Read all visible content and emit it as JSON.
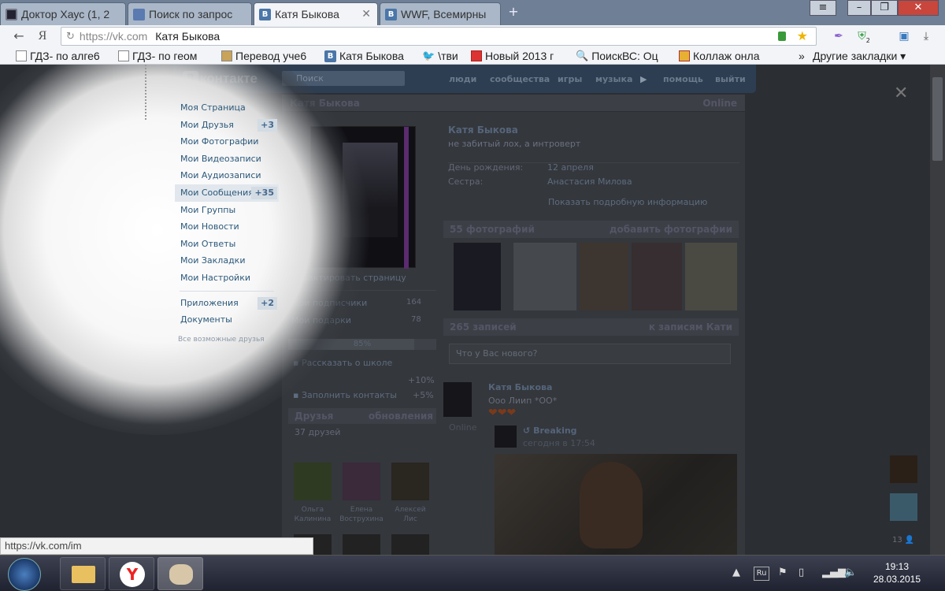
{
  "tabs": [
    {
      "title": "Доктор Хаус (1, 2",
      "icon": "film-icon"
    },
    {
      "title": "Поиск по запрос",
      "icon": "video-icon"
    },
    {
      "title": "Катя Быкова",
      "icon": "vk-icon"
    },
    {
      "title": "WWF, Всемирны",
      "icon": "vk-icon"
    }
  ],
  "toolbar": {
    "yandex_label": "Я",
    "url": "https://vk.com",
    "page_title": "Катя Быкова",
    "ext_badge": "2"
  },
  "bookmarks": [
    {
      "label": "ГДЗ- по алге6",
      "icon": "document-icon"
    },
    {
      "label": "ГДЗ- по геом",
      "icon": "document-icon"
    },
    {
      "label": "Перевод уче6",
      "icon": "translate-icon"
    },
    {
      "label": "Катя Быкова",
      "icon": "vk-icon"
    },
    {
      "label": "\\тви",
      "icon": "twitter-icon"
    },
    {
      "label": "Новый 2013 г",
      "icon": "gift-icon"
    },
    {
      "label": "ПоискВС: Оц",
      "icon": "search-icon"
    },
    {
      "label": "Коллаж онла",
      "icon": "collage-icon"
    }
  ],
  "bookmarks_more": "»",
  "bookmarks_other": "Другие закладки ▾",
  "vk": {
    "logo_text": "контакте",
    "logo_letter": "В",
    "search_placeholder": "Поиск",
    "nav": [
      "люди",
      "сообщества",
      "игры",
      "музыка",
      "помощь",
      "выйти"
    ],
    "sidebar": [
      {
        "label": "Моя Страница",
        "count": ""
      },
      {
        "label": "Мои Друзья",
        "count": "+3"
      },
      {
        "label": "Мои Фотографии",
        "count": ""
      },
      {
        "label": "Мои Видеозаписи",
        "count": ""
      },
      {
        "label": "Мои Аудиозаписи",
        "count": ""
      },
      {
        "label": "Мои Сообщения",
        "count": "+35"
      },
      {
        "label": "Мои Группы",
        "count": ""
      },
      {
        "label": "Мои Новости",
        "count": ""
      },
      {
        "label": "Мои Ответы",
        "count": ""
      },
      {
        "label": "Мои Закладки",
        "count": ""
      },
      {
        "label": "Мои Настройки",
        "count": ""
      }
    ],
    "sidebar2": [
      {
        "label": "Приложения",
        "count": "+2"
      },
      {
        "label": "Документы",
        "count": ""
      }
    ],
    "all_friends": "Все возможные друзья",
    "profile": {
      "header_name": "Катя Быкова",
      "online": "Online",
      "name": "Катя Быкова",
      "status": "не забитый лох, а интроверт",
      "birthday_label": "День рождения:",
      "birthday_value": "12 апреля",
      "sister_label": "Сестра:",
      "sister_value": "Анастасия Милова",
      "more_info": "Показать подробную информацию",
      "edit_page": "Редактировать страницу",
      "subscribers_label": "Мои подписчики",
      "subscribers_count": "164",
      "gifts_label": "Мои подарки",
      "gifts_count": "78",
      "completion": "85%",
      "completion_value": 0.85,
      "school_label": "Рассказать о школе",
      "school_bonus": "+10%",
      "contacts_label": "Заполнить контакты",
      "contacts_bonus": "+5%",
      "friends_title": "Друзья",
      "friends_updates": "обновления",
      "friends_count": "37 друзей",
      "friends": [
        {
          "first": "Ольга",
          "last": "Калинина"
        },
        {
          "first": "Елена",
          "last": "Вострухина"
        },
        {
          "first": "Алексей",
          "last": "Лис"
        }
      ],
      "photos_title": "55 фотографий",
      "photos_add": "добавить фотографии",
      "posts_title": "265 записей",
      "posts_link": "к записям Кати",
      "post_placeholder": "Что у Вас нового?",
      "post_author": "Катя Быкова",
      "post_text": "Ооо Лиип *ОО*",
      "post_hearts": "❤❤❤",
      "post_online": "Online",
      "repost_source": "Breaking",
      "repost_time": "сегодня в 17:54",
      "right_count": "13"
    }
  },
  "status_url": "https://vk.com/im",
  "taskbar": {
    "lang": "Ru",
    "time": "19:13",
    "date": "28.03.2015"
  }
}
